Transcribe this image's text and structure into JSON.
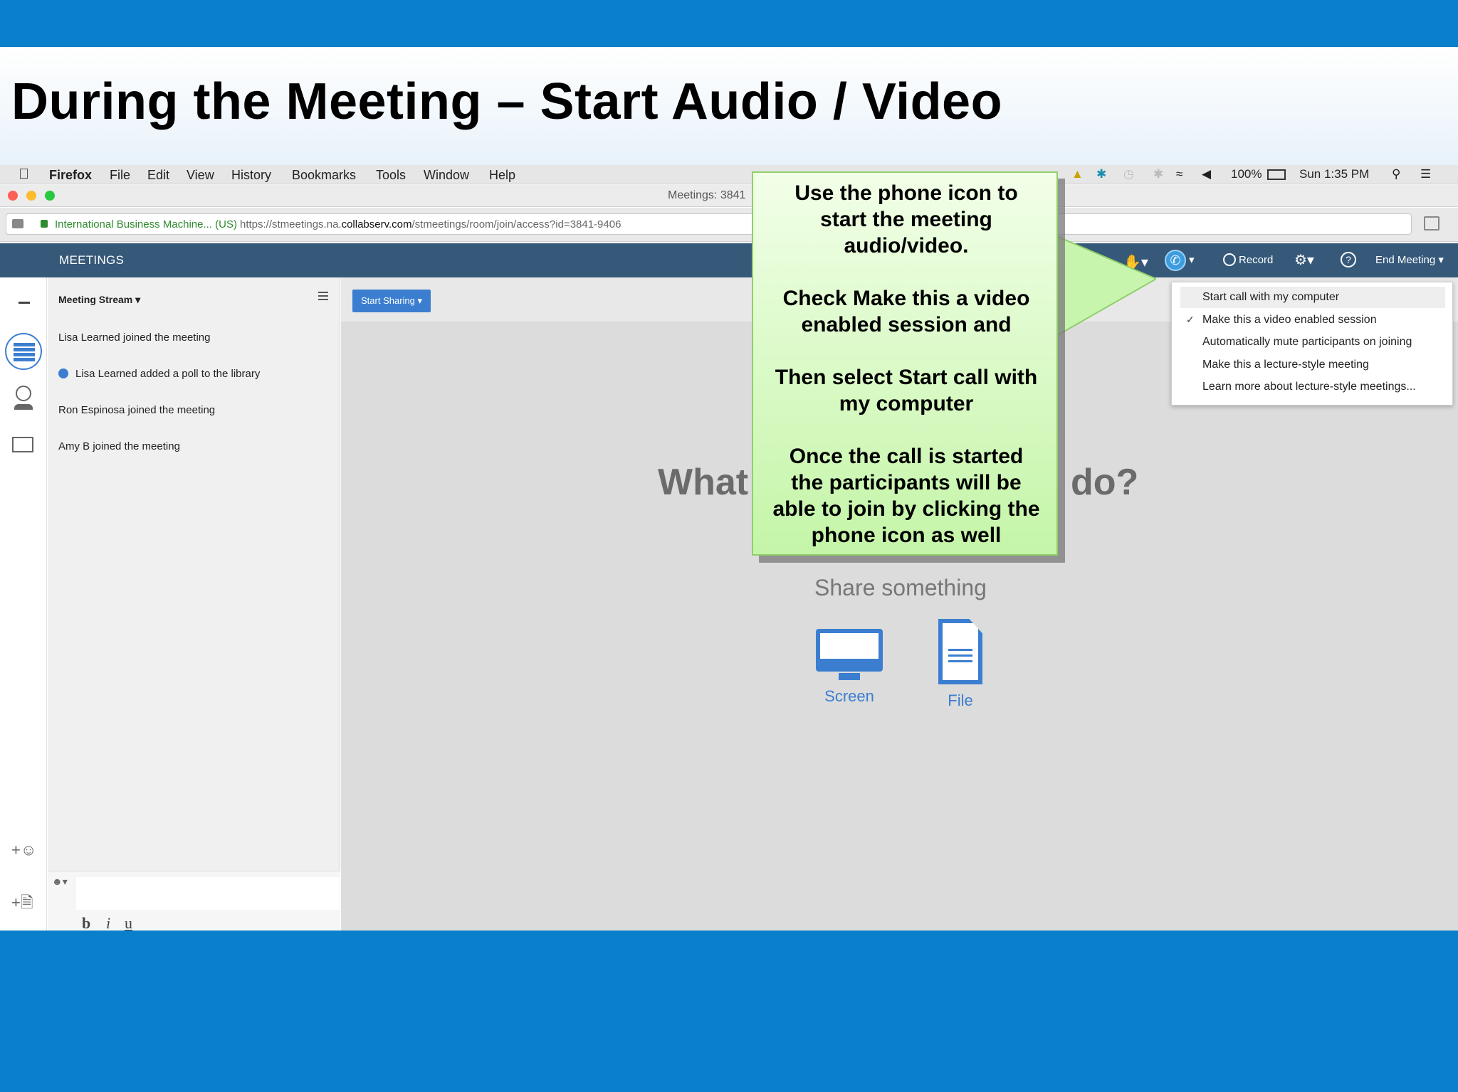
{
  "slide": {
    "title": "During the Meeting – Start Audio / Video"
  },
  "mac_menubar": {
    "app": "Firefox",
    "menus": [
      "File",
      "Edit",
      "View",
      "History",
      "Bookmarks",
      "Tools",
      "Window",
      "Help"
    ],
    "battery": "100%",
    "clock": "Sun 1:35 PM"
  },
  "browser": {
    "window_title": "Meetings: 3841",
    "site_identity": "International Business Machine...",
    "site_country": "(US)",
    "url_prefix": "https://stmeetings.na.",
    "url_domain": "collabserv.com",
    "url_path": "/stmeetings/room/join/access?id=3841-9406"
  },
  "app_header": {
    "app_name": "MEETINGS",
    "record_label": "Record",
    "help_label": "?",
    "end_meeting_label": "End Meeting"
  },
  "stream": {
    "title": "Meeting Stream",
    "entries": [
      "Lisa Learned joined the meeting",
      "Lisa Learned added a poll to the library",
      "Ron Espinosa joined the meeting",
      "Amy B joined the meeting"
    ],
    "format_bold": "b",
    "format_italic": "i",
    "format_underline": "u"
  },
  "main": {
    "start_sharing_label": "Start Sharing",
    "question_left": "What",
    "question_right": "do?",
    "share_heading": "Share something",
    "share_screen_label": "Screen",
    "share_file_label": "File"
  },
  "audio_menu": {
    "items": [
      "Start call with my computer",
      "Make this a video enabled session",
      "Automatically mute participants on joining",
      "Make this a lecture-style meeting",
      "Learn more about lecture-style meetings..."
    ],
    "check_mark": "✓"
  },
  "callout": {
    "p1_l1": "Use the phone icon to",
    "p1_l2": "start the meeting",
    "p1_l3": "audio/video.",
    "p2_l1": "Check Make this a video",
    "p2_l2": "enabled session and",
    "p3_l1": "Then select Start call with",
    "p3_l2": "my computer",
    "p4_l1": "Once the call is started",
    "p4_l2": "the participants will be",
    "p4_l3": "able to join by clicking the",
    "p4_l4": "phone icon as well"
  },
  "colors": {
    "slide_band": "#0a7fcb",
    "app_header": "#36597a",
    "accent_blue": "#3b7ed0",
    "callout_green": "#c4f5a8"
  }
}
